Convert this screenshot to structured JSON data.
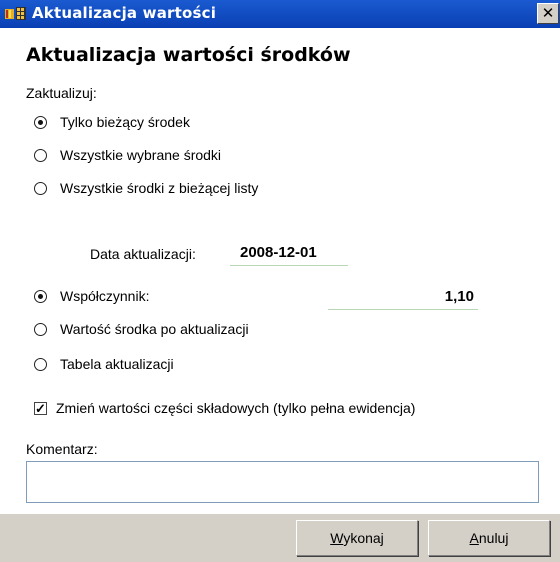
{
  "window": {
    "title": "Aktualizacja wartości",
    "close_glyph": "✕"
  },
  "dialog": {
    "heading": "Aktualizacja wartości środków",
    "scope_label": "Zaktualizuj:",
    "scope_options": [
      {
        "label": "Tylko bieżący środek",
        "checked": true
      },
      {
        "label": "Wszystkie wybrane środki",
        "checked": false
      },
      {
        "label": "Wszystkie środki z bieżącej listy",
        "checked": false
      }
    ],
    "date_label": "Data aktualizacji:",
    "date_value": "2008-12-01",
    "method_options": [
      {
        "label": "Współczynnik:",
        "checked": true
      },
      {
        "label": "Wartość środka po aktualizacji",
        "checked": false
      },
      {
        "label": "Tabela aktualizacji",
        "checked": false
      }
    ],
    "coefficient_value": "1,10",
    "components_checkbox": {
      "label": "Zmień wartości części składowych (tylko pełna ewidencja)",
      "checked": true,
      "check_glyph": "✓"
    },
    "comment_label": "Komentarz:",
    "comment_value": ""
  },
  "buttons": {
    "execute_underline": "W",
    "execute_rest": "ykonaj",
    "cancel_underline": "A",
    "cancel_rest": "nuluj"
  },
  "colors": {
    "titlebar": "#0a3fb3",
    "footer": "#d4d0c8"
  }
}
